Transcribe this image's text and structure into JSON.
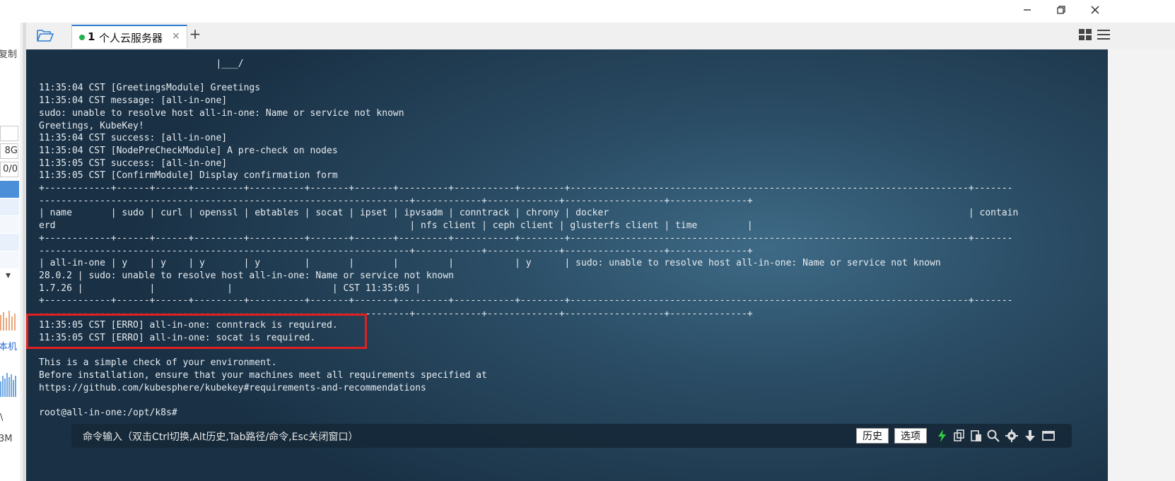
{
  "window": {
    "minimize_icon": "minimize-icon",
    "maximize_icon": "restore-icon",
    "close_icon": "close-icon"
  },
  "tabs": {
    "active": {
      "number": "1",
      "label": "个人云服务器",
      "status_color": "#22b14c"
    },
    "close_glyph": "×",
    "add_glyph": "+"
  },
  "left_panel": {
    "copy_label": "复制",
    "value_mem": "8G",
    "value_ratio": "0/0",
    "this_machine": "本机",
    "size_value": "3M",
    "dropdown_glyph": "▾",
    "marker": "\\"
  },
  "terminal": {
    "lines": [
      "                                |___/",
      "",
      "11:35:04 CST [GreetingsModule] Greetings",
      "11:35:04 CST message: [all-in-one]",
      "sudo: unable to resolve host all-in-one: Name or service not known",
      "Greetings, KubeKey!",
      "11:35:04 CST success: [all-in-one]",
      "11:35:04 CST [NodePreCheckModule] A pre-check on nodes",
      "11:35:05 CST success: [all-in-one]",
      "11:35:05 CST [ConfirmModule] Display confirmation form",
      "+------------+------+------+---------+----------+-------+-------+---------+-----------+--------+------------------------------------------------------------------------+-------",
      "-------------------------------------------------------------------+------------+-------------+------------------+--------------+",
      "| name       | sudo | curl | openssl | ebtables | socat | ipset | ipvsadm | conntrack | chrony | docker                                                                 | contain",
      "erd                                                                | nfs client | ceph client | glusterfs client | time         |",
      "+------------+------+------+---------+----------+-------+-------+---------+-----------+--------+------------------------------------------------------------------------+-------",
      "-------------------------------------------------------------------+------------+-------------+------------------+--------------+",
      "| all-in-one | y    | y    | y       | y        |       |       |         |           | y      | sudo: unable to resolve host all-in-one: Name or service not known",
      "28.0.2 | sudo: unable to resolve host all-in-one: Name or service not known",
      "1.7.26 |            |             |                  | CST 11:35:05 |",
      "+------------+------+------+---------+----------+-------+-------+---------+-----------+--------+------------------------------------------------------------------------+-------",
      "-------------------------------------------------------------------+------------+-------------+------------------+--------------+",
      "11:35:05 CST [ERRO] all-in-one: conntrack is required.",
      "11:35:05 CST [ERRO] all-in-one: socat is required.",
      "",
      "This is a simple check of your environment.",
      "Before installation, ensure that your machines meet all requirements specified at",
      "https://github.com/kubesphere/kubekey#requirements-and-recommendations",
      "",
      "root@all-in-one:/opt/k8s#"
    ],
    "error_highlight_color": "#e02020"
  },
  "command_bar": {
    "prompt": "命令输入（双击Ctrl切换,Alt历史,Tab路径/命令,Esc关闭窗口）",
    "history_button": "历史",
    "options_button": "选项",
    "icons": [
      "lightning-icon",
      "copy-icon",
      "paste-icon",
      "search-icon",
      "gear-icon",
      "download-icon",
      "window-icon"
    ],
    "lightning_color": "#2ecc40"
  }
}
